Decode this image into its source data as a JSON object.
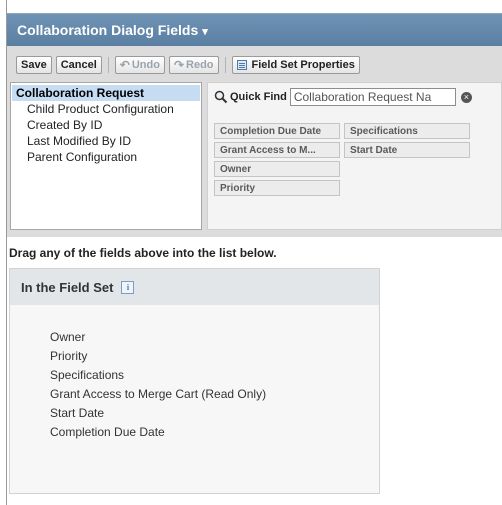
{
  "header": {
    "title": "Collaboration Dialog Fields",
    "caret": "▾"
  },
  "toolbar": {
    "save": "Save",
    "cancel": "Cancel",
    "undo": "Undo",
    "redo": "Redo",
    "field_set_properties": "Field Set Properties"
  },
  "objects": [
    "Collaboration Request",
    "Child Product Configuration",
    "Created By ID",
    "Last Modified By ID",
    "Parent Configuration"
  ],
  "quick_find": {
    "label": "Quick Find",
    "value": "Collaboration Request Na",
    "clear": "×"
  },
  "available_fields": {
    "col1": [
      "Completion Due Date",
      "Grant Access to M...",
      "Owner",
      "Priority"
    ],
    "col2": [
      "Specifications",
      "Start Date"
    ]
  },
  "hint": "Drag any of the fields above into the list below.",
  "field_set": {
    "title": "In the Field Set",
    "info": "i",
    "items": [
      "Owner",
      "Priority",
      "Specifications",
      "Grant Access to Merge Cart (Read Only)",
      "Start Date",
      "Completion Due Date"
    ]
  }
}
